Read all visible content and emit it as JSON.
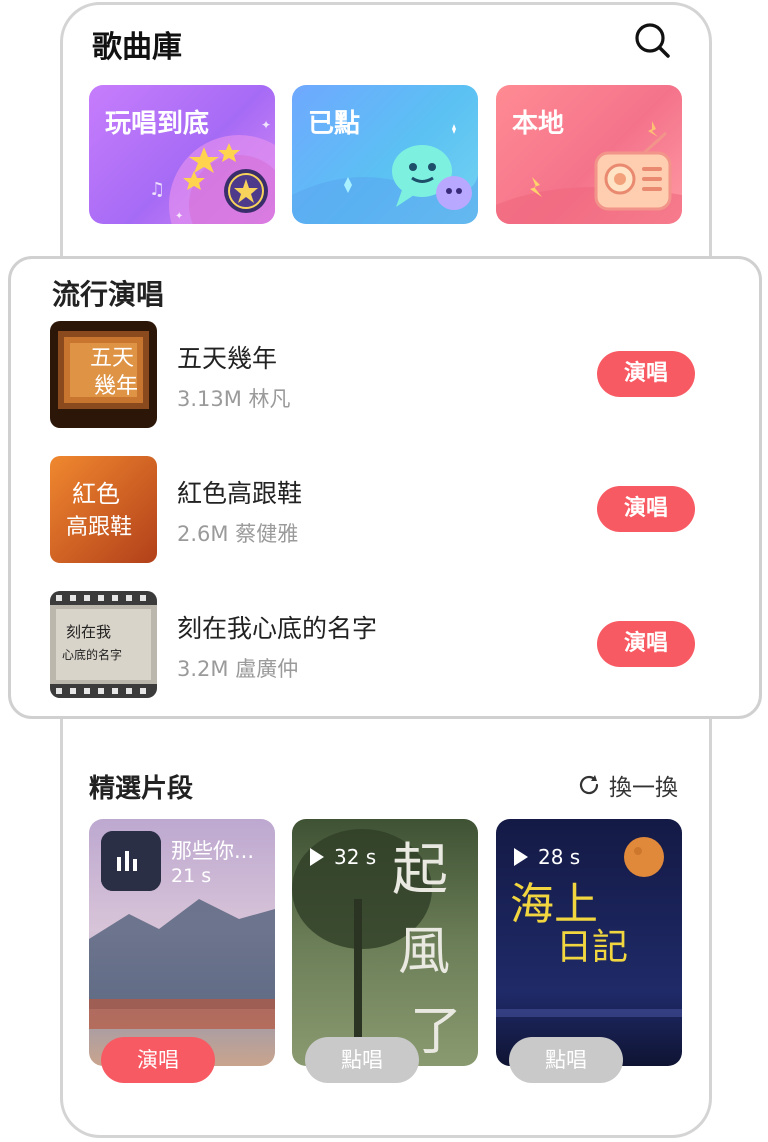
{
  "header": {
    "title": "歌曲庫",
    "search_icon": "search-icon"
  },
  "categories": [
    {
      "label": "玩唱到底",
      "color": "#b675f8"
    },
    {
      "label": "已點",
      "color": "#62b5f8"
    },
    {
      "label": "本地",
      "color": "#f77d8e"
    }
  ],
  "popular": {
    "title": "流行演唱",
    "songs": [
      {
        "title": "五天幾年",
        "meta": "3.13M 林凡",
        "button": "演唱",
        "cover_text": [
          "五天",
          "幾年"
        ]
      },
      {
        "title": "紅色高跟鞋",
        "meta": "2.6M 蔡健雅",
        "button": "演唱",
        "cover_text": [
          "紅色",
          "高跟鞋"
        ]
      },
      {
        "title": "刻在我心底的名字",
        "meta": "3.2M 盧廣仲",
        "button": "演唱",
        "cover_text": [
          "刻在我",
          "心底的名字"
        ]
      }
    ]
  },
  "highlights": {
    "title": "精選片段",
    "refresh_label": "換一換",
    "clips": [
      {
        "name": "那些你...",
        "duration": "21 s",
        "button": "演唱"
      },
      {
        "duration": "32 s",
        "cover_text": [
          "起",
          "風",
          "了"
        ],
        "button": "點唱"
      },
      {
        "duration": "28 s",
        "cover_text": [
          "海上",
          "日記"
        ],
        "button": "點唱"
      }
    ]
  },
  "colors": {
    "accent": "#f85a63",
    "disabled": "#c9c9c9"
  }
}
